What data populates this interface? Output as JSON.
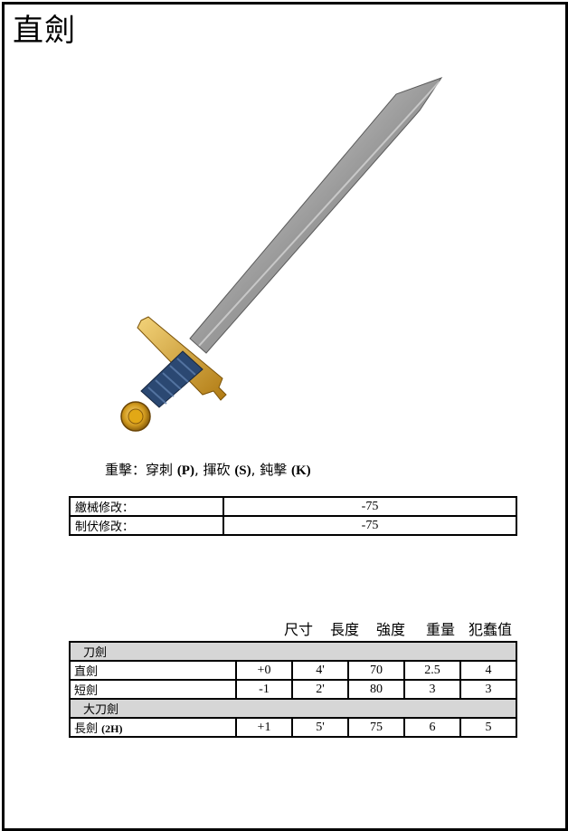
{
  "page": {
    "title": "直劍"
  },
  "damage": {
    "prefix": "重擊：",
    "types": [
      {
        "label": "穿刺",
        "code": "(P)"
      },
      {
        "label": "揮砍",
        "code": "(S)"
      },
      {
        "label": "鈍擊",
        "code": "(K)"
      }
    ]
  },
  "modifiers": [
    {
      "label": "繳械修改：",
      "value": "-75"
    },
    {
      "label": "制伏修改：",
      "value": "-75"
    }
  ],
  "weapon_table": {
    "headers": [
      "尺寸",
      "長度",
      "強度",
      "重量",
      "犯蠢值"
    ],
    "groups": [
      {
        "name": "刀劍",
        "rows": [
          {
            "name": "直劍",
            "note": "",
            "cells": [
              "+0",
              "4'",
              "70",
              "2.5",
              "4"
            ]
          },
          {
            "name": "短劍",
            "note": "",
            "cells": [
              "-1",
              "2'",
              "80",
              "3",
              "3"
            ]
          }
        ]
      },
      {
        "name": "大刀劍",
        "rows": [
          {
            "name": "長劍",
            "note": "(2H)",
            "cells": [
              "+1",
              "5'",
              "75",
              "6",
              "5"
            ]
          }
        ]
      }
    ]
  }
}
